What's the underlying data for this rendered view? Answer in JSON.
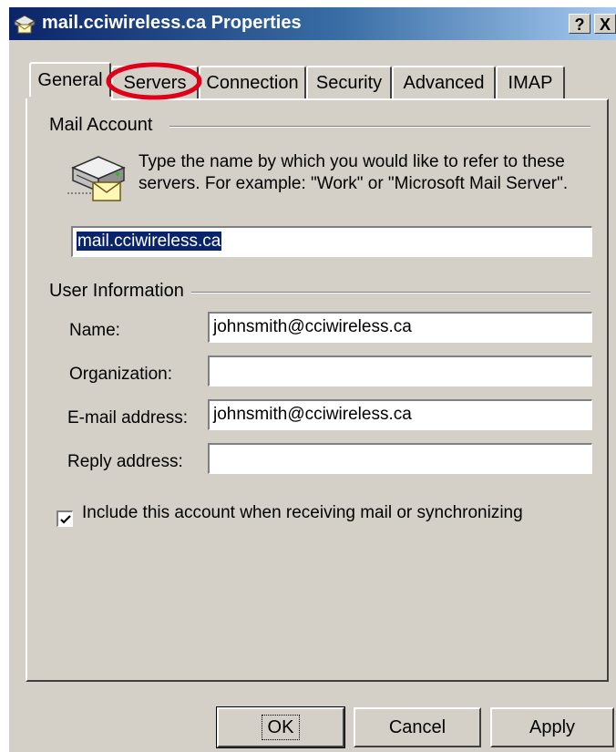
{
  "window": {
    "title": "mail.cciwireless.ca Properties",
    "help_label": "?",
    "close_label": "X"
  },
  "tabs": [
    {
      "label": "General",
      "active": true
    },
    {
      "label": "Servers",
      "highlighted": true
    },
    {
      "label": "Connection"
    },
    {
      "label": "Security"
    },
    {
      "label": "Advanced"
    },
    {
      "label": "IMAP"
    }
  ],
  "mail_account": {
    "group_label": "Mail Account",
    "icon": "mail-server-icon",
    "description": "Type the name by which you would like to refer to these servers.  For example: \"Work\" or \"Microsoft Mail Server\".",
    "account_name_value": "mail.cciwireless.ca"
  },
  "user_information": {
    "group_label": "User Information",
    "name_label": "Name:",
    "name_value": "johnsmith@cciwireless.ca",
    "organization_label": "Organization:",
    "organization_value": "",
    "email_label": "E-mail address:",
    "email_value": "johnsmith@cciwireless.ca",
    "reply_label": "Reply address:",
    "reply_value": ""
  },
  "include_checkbox": {
    "label": "Include this account when receiving mail or synchronizing",
    "checked": true
  },
  "buttons": {
    "ok": "OK",
    "cancel": "Cancel",
    "apply": "Apply"
  },
  "colors": {
    "annotation_circle": "#e0001a",
    "dialog_face": "#d4d0c8",
    "title_bar": "#0a246a"
  }
}
